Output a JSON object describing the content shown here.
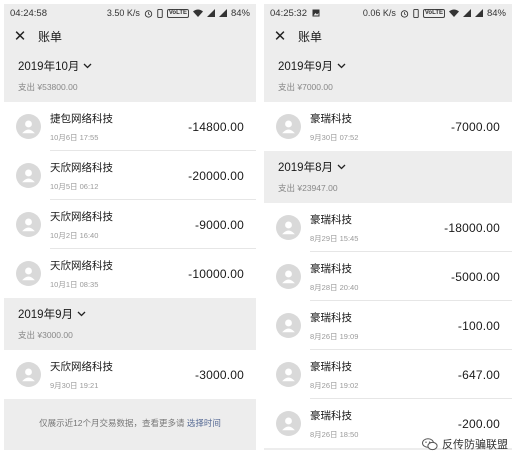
{
  "left": {
    "status": {
      "time": "04:24:58",
      "speed": "3.50 K/s",
      "volte": "VoLTE",
      "battery": "84%"
    },
    "title": "账单",
    "groups": [
      {
        "month": "2019年10月",
        "spent": "支出 ¥53800.00",
        "items": [
          {
            "name": "捷包网络科技",
            "time": "10月6日 17:55",
            "amount": "-14800.00"
          },
          {
            "name": "天欣网络科技",
            "time": "10月5日 06:12",
            "amount": "-20000.00"
          },
          {
            "name": "天欣网络科技",
            "time": "10月2日 16:40",
            "amount": "-9000.00"
          },
          {
            "name": "天欣网络科技",
            "time": "10月1日 08:35",
            "amount": "-10000.00"
          }
        ]
      },
      {
        "month": "2019年9月",
        "spent": "支出 ¥3000.00",
        "items": [
          {
            "name": "天欣网络科技",
            "time": "9月30日 19:21",
            "amount": "-3000.00"
          }
        ]
      }
    ],
    "footer": {
      "note": "仅展示近12个月交易数据，查看更多请 ",
      "link": "选择时间"
    }
  },
  "right": {
    "status": {
      "time": "04:25:32",
      "speed": "0.06 K/s",
      "volte": "VoLTE",
      "battery": "84%"
    },
    "title": "账单",
    "groups": [
      {
        "month": "2019年9月",
        "spent": "支出 ¥7000.00",
        "items": [
          {
            "name": "豪瑞科技",
            "time": "9月30日 07:52",
            "amount": "-7000.00"
          }
        ]
      },
      {
        "month": "2019年8月",
        "spent": "支出 ¥23947.00",
        "items": [
          {
            "name": "豪瑞科技",
            "time": "8月29日 15:45",
            "amount": "-18000.00"
          },
          {
            "name": "豪瑞科技",
            "time": "8月28日 20:40",
            "amount": "-5000.00"
          },
          {
            "name": "豪瑞科技",
            "time": "8月26日 19:09",
            "amount": "-100.00"
          },
          {
            "name": "豪瑞科技",
            "time": "8月26日 19:02",
            "amount": "-647.00"
          },
          {
            "name": "豪瑞科技",
            "time": "8月26日 18:50",
            "amount": "-200.00"
          }
        ]
      }
    ]
  },
  "watermark": "反传防骗联盟",
  "icons": {
    "close": "close-icon",
    "chevron": "chevron-down-icon",
    "avatar": "default-avatar-icon",
    "wifi": "wifi-icon",
    "signal": "signal-icon",
    "alarm": "alarm-icon",
    "battery": "battery-icon",
    "image": "image-icon",
    "wechat": "wechat-icon"
  }
}
